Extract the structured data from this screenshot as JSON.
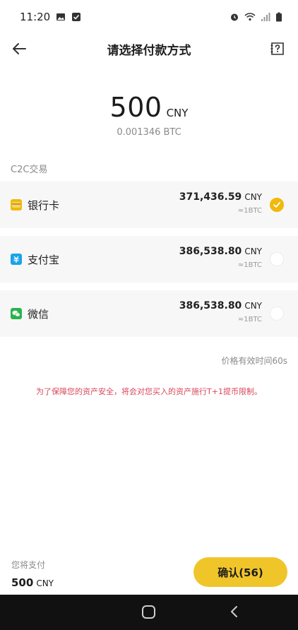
{
  "status_bar": {
    "time": "11:20",
    "icons": [
      "image-icon",
      "check-box-icon",
      "alarm-icon",
      "wifi-icon",
      "signal-icon",
      "battery-icon"
    ]
  },
  "header": {
    "title": "请选择付款方式",
    "back_icon": "arrow-left-icon",
    "help_icon": "help-icon"
  },
  "amount": {
    "value": "500",
    "unit": "CNY",
    "btc": "0.001346 BTC"
  },
  "section_label": "C2C交易",
  "payment_methods": [
    {
      "name": "银行卡",
      "icon": "bank-card-icon",
      "icon_color": "#f0b90b",
      "price": "371,436.59",
      "unit": "CNY",
      "btc": "≈1BTC",
      "selected": true
    },
    {
      "name": "支付宝",
      "icon": "alipay-icon",
      "icon_color": "#1aa3e8",
      "price": "386,538.80",
      "unit": "CNY",
      "btc": "≈1BTC",
      "selected": false
    },
    {
      "name": "微信",
      "icon": "wechat-icon",
      "icon_color": "#2bb24c",
      "price": "386,538.80",
      "unit": "CNY",
      "btc": "≈1BTC",
      "selected": false
    }
  ],
  "validity": "价格有效时间60s",
  "notice": "为了保障您的资产安全，将会对您买入的资产施行T+1提币限制。",
  "footer": {
    "pay_label": "您将支付",
    "pay_amount": "500",
    "pay_unit": "CNY",
    "confirm_label": "确认(56)"
  },
  "colors": {
    "accent": "#f0b90b",
    "button": "#f0c52a",
    "notice": "#d9475b"
  }
}
